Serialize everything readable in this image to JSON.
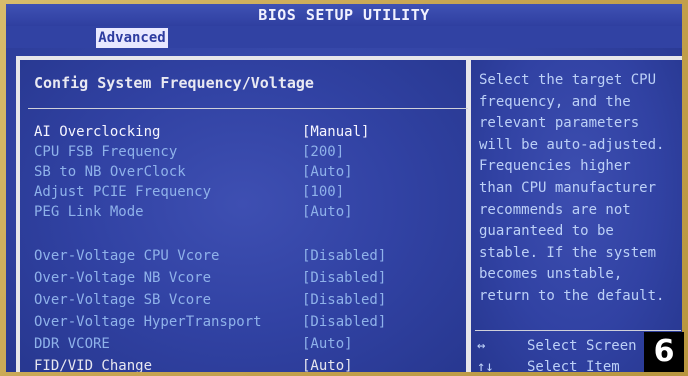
{
  "window": {
    "title": "BIOS SETUP UTILITY",
    "active_tab": "Advanced"
  },
  "main": {
    "heading": "Config System Frequency/Voltage",
    "items": [
      {
        "label": "AI Overclocking",
        "value": "[Manual]"
      },
      {
        "label": "CPU FSB Frequency",
        "value": "[200]"
      },
      {
        "label": "SB to NB OverClock",
        "value": "[Auto]"
      },
      {
        "label": "Adjust PCIE Frequency",
        "value": "[100]"
      },
      {
        "label": "PEG Link Mode",
        "value": "[Auto]"
      },
      {
        "label": "Over-Voltage CPU Vcore",
        "value": "[Disabled]"
      },
      {
        "label": "Over-Voltage NB Vcore",
        "value": "[Disabled]"
      },
      {
        "label": "Over-Voltage SB Vcore",
        "value": "[Disabled]"
      },
      {
        "label": "Over-Voltage HyperTransport",
        "value": "[Disabled]"
      },
      {
        "label": "DDR VCORE",
        "value": "[Auto]"
      },
      {
        "label": "FID/VID Change",
        "value": "[Auto]"
      }
    ]
  },
  "help": {
    "lines": [
      "Select the target CPU",
      "frequency, and the",
      "relevant parameters",
      "will be auto-adjusted.",
      "Frequencies higher",
      "than CPU manufacturer",
      "recommends are not",
      "guaranteed to be",
      "stable. If the system",
      "becomes unstable,",
      "return to the default."
    ],
    "keys": [
      {
        "key": "↔",
        "text": "Select Screen"
      },
      {
        "key": "↑↓",
        "text": "Select Item"
      }
    ]
  },
  "badge": "6"
}
